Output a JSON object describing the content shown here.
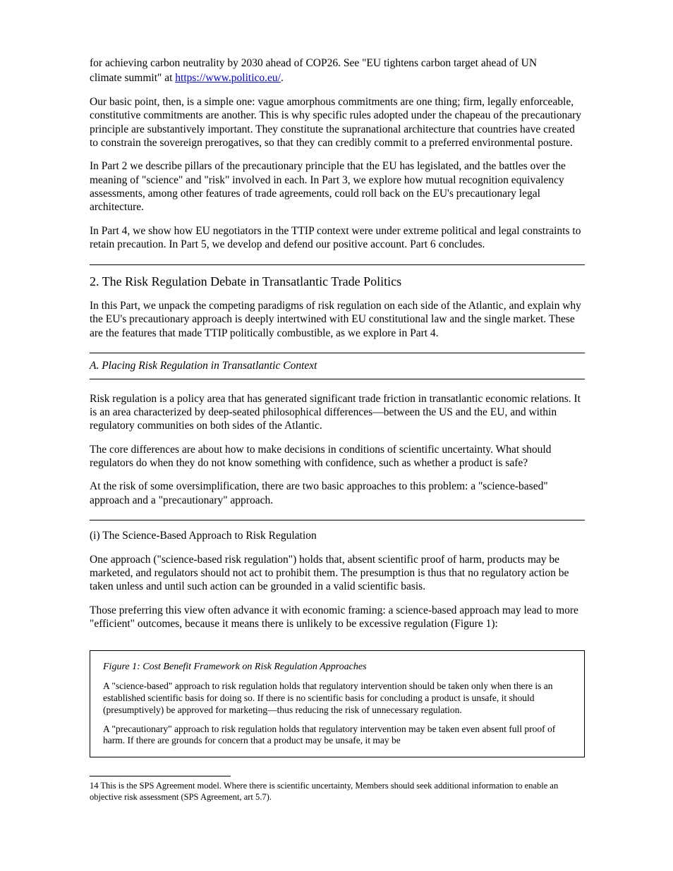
{
  "p1_line1": "for achieving carbon neutrality by 2030 ahead of COP26. See \"EU tightens carbon target ahead of UN",
  "p1_link": "climate summit\" at ",
  "p1_url": "https://www.politico.eu/",
  "p1_tail": ".",
  "p2": "Our basic point, then, is a simple one: vague amorphous commitments are one thing; firm, legally enforceable, constitutive commitments are another. This is why specific rules adopted under the chapeau of the precautionary principle are substantively important. They constitute the supranational architecture that countries have created to constrain the sovereign prerogatives, so that they can credibly commit to a preferred environmental posture.",
  "p3": "In Part 2 we describe pillars of the precautionary principle that the EU has legislated, and the battles over the meaning of \"science\" and \"risk\" involved in each. In Part 3, we explore how mutual recognition equivalency assessments, among other features of trade agreements, could roll back on the EU's precautionary legal architecture.",
  "p4": "In Part 4, we show how EU negotiators in the TTIP context were under extreme political and legal constraints to retain precaution. In Part 5, we develop and defend our positive account. Part 6 concludes.",
  "h1": "2. The Risk Regulation Debate in Transatlantic Trade Politics",
  "p5": "In this Part, we unpack the competing paradigms of risk regulation on each side of the Atlantic, and explain why the EU's precautionary approach is deeply intertwined with EU constitutional law and the single market. These are the features that made TTIP politically combustible, as we explore in Part 4.",
  "h2": "A. Placing Risk Regulation in Transatlantic Context",
  "p6": "Risk regulation is a policy area that has generated significant trade friction in transatlantic economic relations. It is an area characterized by deep-seated philosophical differences—between the US and the EU, and within regulatory communities on both sides of the Atlantic.",
  "p7": "The core differences are about how to make decisions in conditions of scientific uncertainty. What should regulators do when they do not know something with confidence, such as whether a product is safe?",
  "p8": "At the risk of some oversimplification, there are two basic approaches to this problem: a \"science-based\" approach and a \"precautionary\" approach.",
  "h3": "(i) The Science-Based Approach to Risk Regulation",
  "p9": "One approach (\"science-based risk regulation\") holds that, absent scientific proof of harm, products may be marketed, and regulators should not act to prohibit them. The presumption is thus that no regulatory action be taken unless and until such action can be grounded in a valid scientific basis.",
  "p10": "Those preferring this view often advance it with economic framing: a science-based approach may lead to more \"efficient\" outcomes, because it means there is unlikely to be excessive regulation (Figure 1):",
  "box_title": "Figure 1: Cost Benefit Framework on Risk Regulation Approaches",
  "box_p1": "A \"science-based\" approach to risk regulation holds that regulatory intervention should be taken only when there is an established scientific basis for doing so. If there is no scientific basis for concluding a product is unsafe, it should (presumptively) be approved for marketing—thus reducing the risk of unnecessary regulation.",
  "box_p2": "A \"precautionary\" approach to risk regulation holds that regulatory intervention may be taken even absent full proof of harm. If there are grounds for concern that a product may be unsafe, it may be",
  "fn_num": "14",
  "fn_text": " This is the SPS Agreement model. Where there is scientific uncertainty, Members should seek additional information to enable an objective risk assessment (SPS Agreement, art 5.7)."
}
